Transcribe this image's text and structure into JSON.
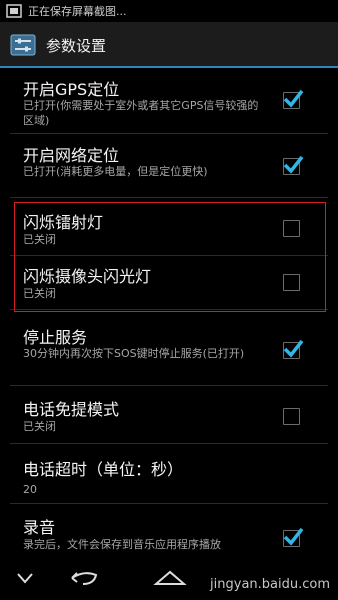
{
  "status_bar": {
    "text": "正在保存屏幕截图..."
  },
  "action_bar": {
    "title": "参数设置"
  },
  "items": [
    {
      "title": "开启GPS定位",
      "summary": "已打开(你需要处于室外或者其它GPS信号较强的区域)",
      "checked": true
    },
    {
      "title": "开启网络定位",
      "summary": "已打开(消耗更多电量，但是定位更快)",
      "checked": true
    },
    {
      "title": "闪烁镭射灯",
      "summary": "已关闭",
      "checked": false
    },
    {
      "title": "闪烁摄像头闪光灯",
      "summary": "已关闭",
      "checked": false
    },
    {
      "title": "停止服务",
      "summary": "30分钟内再次按下SOS键时停止服务(已打开)",
      "checked": true
    },
    {
      "title": "电话免提模式",
      "summary": "已关闭",
      "checked": false
    },
    {
      "title": "电话超时（单位：秒）",
      "summary": "20"
    },
    {
      "title": "录音",
      "summary": "录完后，文件会保存到音乐应用程序播放",
      "checked": true
    }
  ],
  "watermark": {
    "text": "jingyan.baidu.com"
  },
  "accent_color": "#33b5e5"
}
